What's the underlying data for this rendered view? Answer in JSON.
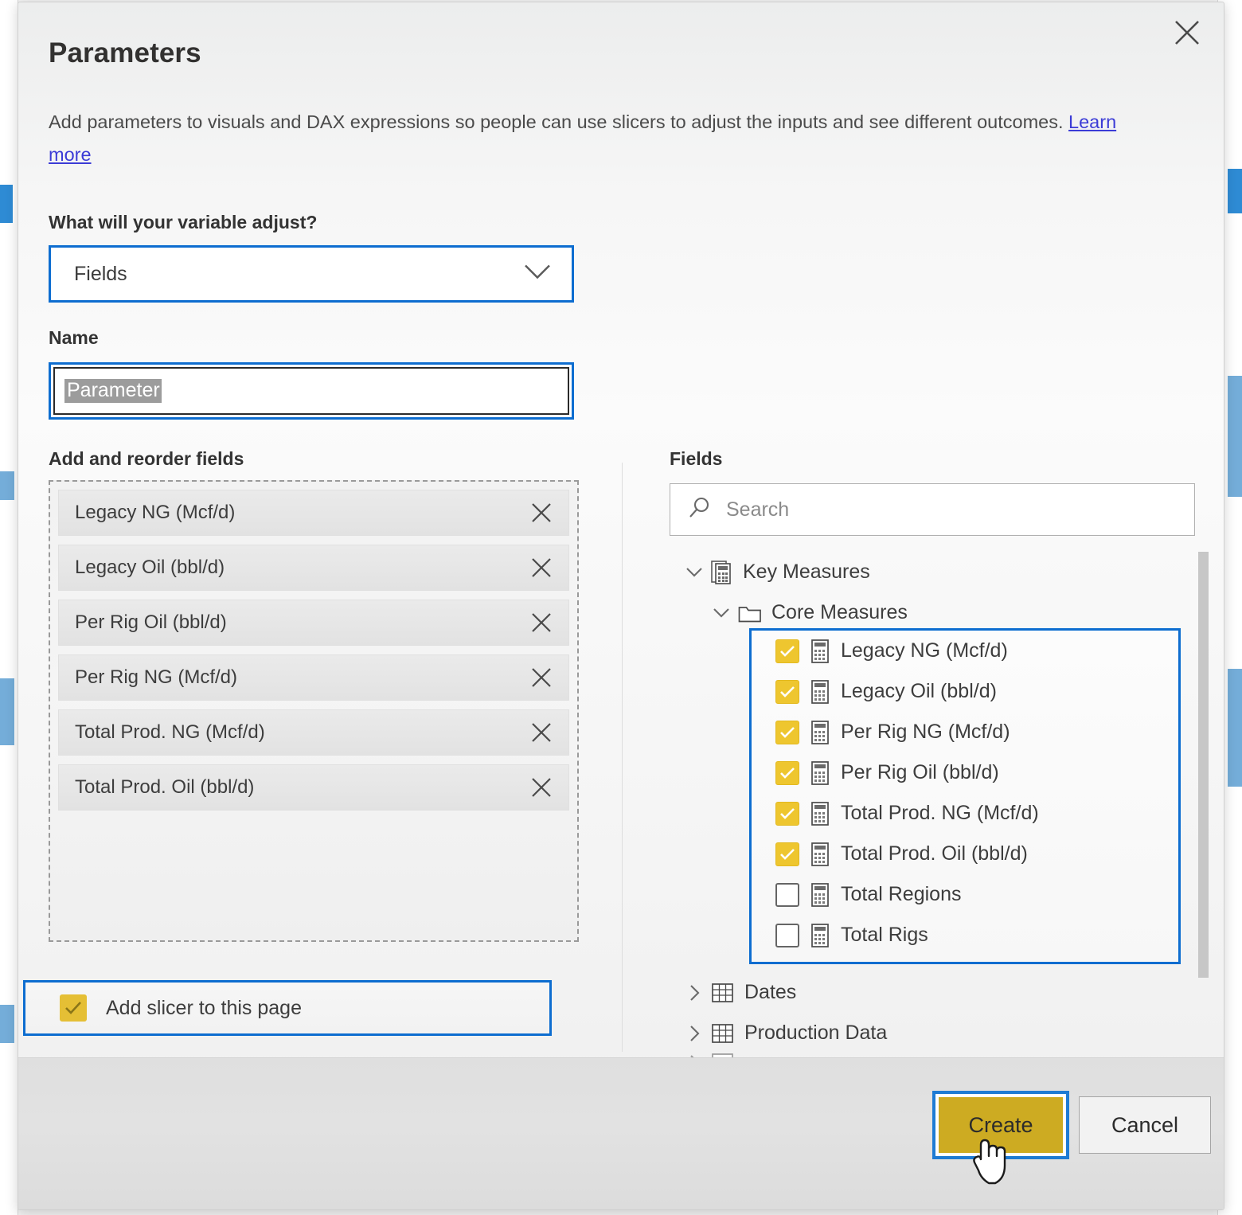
{
  "dialog": {
    "title": "Parameters",
    "description_before_link": "Add parameters to visuals and DAX expressions so people can use slicers to adjust the inputs and see different outcomes. ",
    "learn_more_label": "Learn more",
    "close_icon": "close-icon"
  },
  "variable_adjust": {
    "label": "What will your variable adjust?",
    "selected_value": "Fields",
    "chevron_icon": "chevron-down-icon"
  },
  "name": {
    "label": "Name",
    "value": "Parameter",
    "selected": true
  },
  "add_reorder": {
    "label": "Add and reorder fields",
    "remove_icon": "close-icon",
    "items": [
      {
        "label": "Legacy NG (Mcf/d)"
      },
      {
        "label": "Legacy Oil (bbl/d)"
      },
      {
        "label": "Per Rig Oil (bbl/d)"
      },
      {
        "label": "Per Rig NG (Mcf/d)"
      },
      {
        "label": "Total Prod. NG (Mcf/d)"
      },
      {
        "label": "Total Prod. Oil (bbl/d)"
      }
    ]
  },
  "add_slicer": {
    "label": "Add slicer to this page",
    "checked": true,
    "checkbox_icon": "checkmark-icon"
  },
  "fields_panel": {
    "label": "Fields",
    "search_placeholder": "Search",
    "search_value": "",
    "search_icon": "search-icon",
    "tree": {
      "root": {
        "label": "Key Measures",
        "icon": "measure-table-icon",
        "chevron": "chevron-expanded-icon",
        "expanded": true
      },
      "folder": {
        "label": "Core Measures",
        "icon": "folder-icon",
        "chevron": "chevron-expanded-icon",
        "expanded": true
      },
      "measures": [
        {
          "label": "Legacy NG (Mcf/d)",
          "checked": true,
          "icon": "measure-icon"
        },
        {
          "label": "Legacy Oil (bbl/d)",
          "checked": true,
          "icon": "measure-icon"
        },
        {
          "label": "Per Rig NG (Mcf/d)",
          "checked": true,
          "icon": "measure-icon"
        },
        {
          "label": "Per Rig Oil (bbl/d)",
          "checked": true,
          "icon": "measure-icon"
        },
        {
          "label": "Total Prod. NG (Mcf/d)",
          "checked": true,
          "icon": "measure-icon"
        },
        {
          "label": "Total Prod. Oil (bbl/d)",
          "checked": true,
          "icon": "measure-icon"
        },
        {
          "label": "Total Regions",
          "checked": false,
          "icon": "measure-icon"
        },
        {
          "label": "Total Rigs",
          "checked": false,
          "icon": "measure-icon"
        }
      ],
      "tables": [
        {
          "label": "Dates",
          "icon": "table-icon",
          "chevron": "chevron-collapsed-icon",
          "expanded": false
        },
        {
          "label": "Production Data",
          "icon": "table-icon",
          "chevron": "chevron-collapsed-icon",
          "expanded": false
        }
      ]
    }
  },
  "footer": {
    "create_label": "Create",
    "cancel_label": "Cancel"
  },
  "colors": {
    "accent_blue": "#0d6dd0",
    "primary_gold": "#cdab22",
    "checkbox_gold": "#eec62f",
    "link_blue": "#3b3bd6",
    "dialog_bg": "#f6f6f6",
    "footer_bg": "#e0e0e0"
  }
}
